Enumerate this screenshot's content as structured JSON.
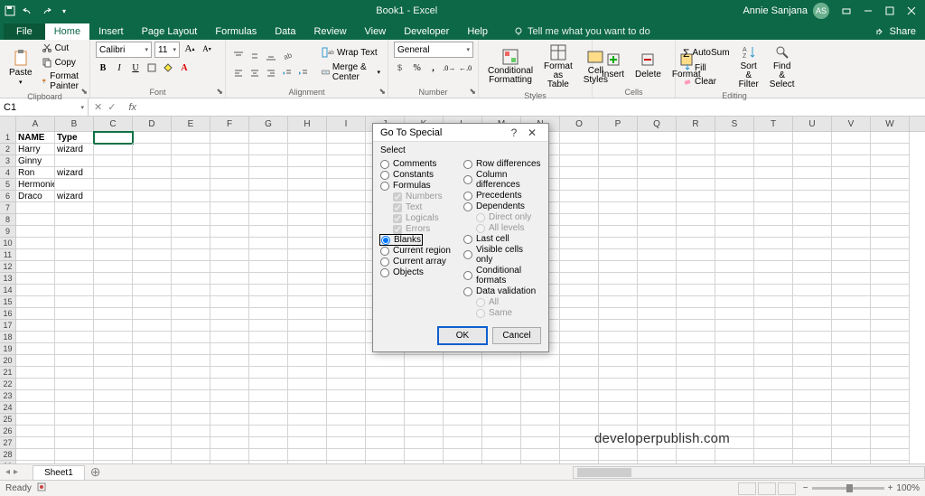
{
  "titlebar": {
    "title": "Book1 - Excel",
    "user": "Annie Sanjana",
    "user_initials": "AS"
  },
  "tabs": {
    "file": "File",
    "home": "Home",
    "insert": "Insert",
    "page_layout": "Page Layout",
    "formulas": "Formulas",
    "data": "Data",
    "review": "Review",
    "view": "View",
    "developer": "Developer",
    "help": "Help",
    "search": "Tell me what you want to do",
    "share": "Share"
  },
  "ribbon": {
    "clipboard": {
      "label": "Clipboard",
      "paste": "Paste",
      "cut": "Cut",
      "copy": "Copy",
      "painter": "Format Painter"
    },
    "font": {
      "label": "Font",
      "name": "Calibri",
      "size": "11"
    },
    "alignment": {
      "label": "Alignment",
      "wrap": "Wrap Text",
      "merge": "Merge & Center"
    },
    "number": {
      "label": "Number",
      "format": "General"
    },
    "styles": {
      "label": "Styles",
      "conditional": "Conditional Formatting",
      "table": "Format as Table",
      "cell": "Cell Styles"
    },
    "cells": {
      "label": "Cells",
      "insert": "Insert",
      "delete": "Delete",
      "format": "Format"
    },
    "editing": {
      "label": "Editing",
      "autosum": "AutoSum",
      "fill": "Fill",
      "clear": "Clear",
      "sort": "Sort & Filter",
      "find": "Find & Select"
    }
  },
  "namebox": "C1",
  "sheet": {
    "cols": [
      "A",
      "B",
      "C",
      "D",
      "E",
      "F",
      "G",
      "H",
      "I",
      "J",
      "K",
      "L",
      "M",
      "N",
      "O",
      "P",
      "Q",
      "R",
      "S",
      "T",
      "U",
      "V",
      "W"
    ],
    "data": [
      [
        "NAME",
        "Type"
      ],
      [
        "Harry",
        "wizard"
      ],
      [
        "Ginny",
        ""
      ],
      [
        "Ron",
        "wizard"
      ],
      [
        "Hermonie",
        ""
      ],
      [
        "Draco",
        "wizard"
      ]
    ]
  },
  "dialog": {
    "title": "Go To Special",
    "select": "Select",
    "left": {
      "comments": "Comments",
      "constants": "Constants",
      "formulas": "Formulas",
      "numbers": "Numbers",
      "text": "Text",
      "logicals": "Logicals",
      "errors": "Errors",
      "blanks": "Blanks",
      "region": "Current region",
      "array": "Current array",
      "objects": "Objects"
    },
    "right": {
      "rowdiff": "Row differences",
      "coldiff": "Column differences",
      "precedents": "Precedents",
      "dependents": "Dependents",
      "direct": "Direct only",
      "alllevels": "All levels",
      "last": "Last cell",
      "visible": "Visible cells only",
      "condfmt": "Conditional formats",
      "validation": "Data validation",
      "all": "All",
      "same": "Same"
    },
    "ok": "OK",
    "cancel": "Cancel"
  },
  "watermark": "developerpublish.com",
  "sheet_tab": "Sheet1",
  "status": {
    "ready": "Ready",
    "zoom": "100%"
  }
}
